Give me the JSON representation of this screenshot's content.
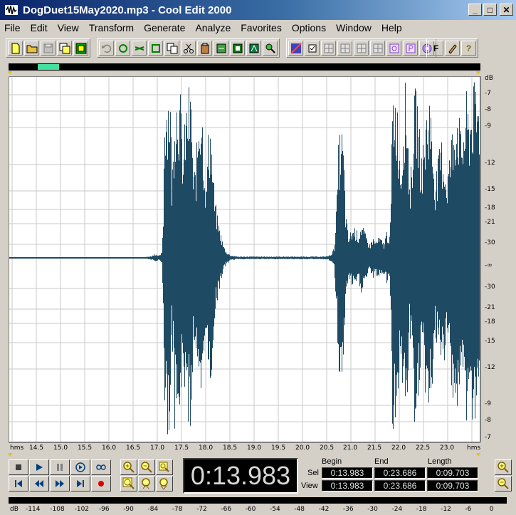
{
  "window": {
    "title": "DogDuet15May2020.mp3 - Cool Edit 2000",
    "minimize": "_",
    "maximize": "□",
    "close": "✕"
  },
  "menu": [
    "File",
    "Edit",
    "View",
    "Transform",
    "Generate",
    "Analyze",
    "Favorites",
    "Options",
    "Window",
    "Help"
  ],
  "toolbar": {
    "group1": [
      "new-file-icon",
      "open-folder-icon",
      "save-disabled-icon",
      "save-as-icon",
      "record-mode-icon"
    ],
    "group2": [
      "undo-icon",
      "repeat-icon",
      "scissors-mix-icon",
      "crop-icon",
      "copy-icon",
      "cut-icon",
      "paste-icon",
      "paste-mix-icon",
      "convert-icon",
      "mix-paste-icon",
      "loop-paste-icon"
    ],
    "group3": [
      "frequency-analysis-icon",
      "checkbox-icon",
      "grid1-icon",
      "grid2-icon",
      "grid3-icon",
      "grid4-icon",
      "cue-icon",
      "play-list-icon",
      "cd-icon"
    ],
    "group4": [
      "f-icon",
      "edit-pencil-icon",
      "help-icon"
    ],
    "help_glyph": "?",
    "f_glyph": "F"
  },
  "waveform": {
    "color": "#1f4a63",
    "grid_color": "#c8c8c8",
    "db_labels": [
      "dB",
      "-7",
      "-8",
      "-9",
      "-12",
      "-15",
      "-18",
      "-21",
      "-30",
      "-∞",
      "-30",
      "-21",
      "-18",
      "-15",
      "-12",
      "-9",
      "-8",
      "-7"
    ],
    "time_labels": [
      "hms",
      "14.5",
      "15.0",
      "15.5",
      "16.0",
      "16.5",
      "17.0",
      "17.5",
      "18.0",
      "18.5",
      "19.0",
      "19.5",
      "20.0",
      "20.5",
      "21.0",
      "21.5",
      "22.0",
      "22.5",
      "23.0",
      "hms"
    ]
  },
  "transport": {
    "buttons": [
      "stop-icon",
      "play-icon",
      "pause-icon",
      "play-to-end-icon",
      "loop-icon",
      "go-to-start-icon",
      "rewind-icon",
      "fast-forward-icon",
      "go-to-end-icon",
      "record-icon"
    ]
  },
  "time_display": "0:13.983",
  "selection": {
    "headers": [
      "Begin",
      "End",
      "Length"
    ],
    "rows": [
      {
        "label": "Sel",
        "begin": "0:13.983",
        "end": "0:23.686",
        "length": "0:09.703"
      },
      {
        "label": "View",
        "begin": "0:13.983",
        "end": "0:23.686",
        "length": "0:09.703"
      }
    ]
  },
  "level_meter": {
    "labels": [
      "dB",
      "-114",
      "-108",
      "-102",
      "-96",
      "-90",
      "-84",
      "-78",
      "-72",
      "-66",
      "-60",
      "-54",
      "-48",
      "-42",
      "-36",
      "-30",
      "-24",
      "-18",
      "-12",
      "-6",
      "0"
    ]
  }
}
